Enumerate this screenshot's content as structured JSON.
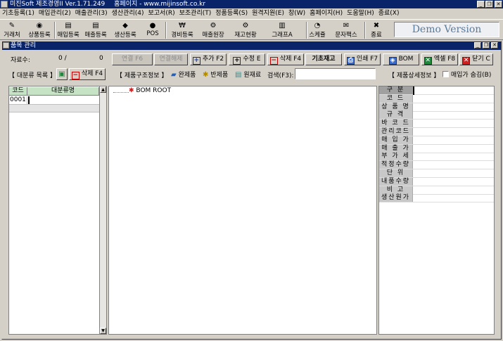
{
  "window": {
    "title_parts": [
      "미진Soft 제조경영II Ver.1.71.249",
      "홈페이지 - www.mijinsoft.co.kr"
    ],
    "min_label": "_",
    "restore_label": "❐",
    "close_label": "✕"
  },
  "menu": [
    "기초등록(1)",
    "매입관리(2)",
    "매출관리(3)",
    "생산관리(4)",
    "보고서(R)",
    "보조관리(T)",
    "정품등록(S)",
    "원격지원(E)",
    "창(W)",
    "홈페이지(H)",
    "도움말(H)",
    "종료(X)"
  ],
  "toolbar": [
    {
      "label": "거래처",
      "icon": "✎"
    },
    {
      "label": "상품등록",
      "icon": "◉"
    },
    {
      "label": "매입등록",
      "icon": "▤"
    },
    {
      "label": "매출등록",
      "icon": "▤"
    },
    {
      "label": "생산등록",
      "icon": "◆"
    },
    {
      "label": "POS",
      "icon": "●"
    },
    {
      "label": "경비등록",
      "icon": "₩"
    },
    {
      "label": "매출원장",
      "icon": "⚙"
    },
    {
      "label": "재고현황",
      "icon": "⚙"
    },
    {
      "label": "그래프A",
      "icon": "▥"
    },
    {
      "label": "스케쥴",
      "icon": "◔"
    },
    {
      "label": "문자팩스",
      "icon": "✉"
    },
    {
      "label": "종료",
      "icon": "✖"
    }
  ],
  "demo_text": "Demo Version",
  "child": {
    "title": "품목 관리",
    "record_label": "자료수:",
    "record_value": "0 /",
    "record_total": "0",
    "buttons": {
      "link": "연결 F6",
      "unlink": "연결해제",
      "add": "추가 F2",
      "edit": "수정 E",
      "delete": "삭제 F4",
      "base_stock": "기초재고",
      "print": "인쇄 F7",
      "bom": "BOM",
      "excel": "엑셀 F8",
      "close": "닫기 C"
    }
  },
  "left_section": {
    "title": "【 대분류 목록 】",
    "delete_label": "삭제 F4",
    "col_code": "코드",
    "col_name": "대분류명",
    "rows": [
      {
        "code": "0001",
        "name": ""
      }
    ]
  },
  "center_section": {
    "title": "【 제품구조정보 】",
    "finished": "완제품",
    "semi": "반제품",
    "raw": "원재료",
    "search_label": "검색(F3):",
    "search_value": "",
    "tree_root": "BOM ROOT"
  },
  "right_section": {
    "title": "【 제품상세정보 】",
    "hide_cost_label": "매입가 숨김(B)",
    "hide_cost_checked": false,
    "props": [
      "구 분",
      "코 드",
      "상 품 명",
      "규 격",
      "바 코 드",
      "관리코드",
      "매 입 가",
      "매 출 가",
      "부 가 세",
      "적정수량",
      "단 위",
      "내품수량",
      "비 고",
      "생산원가"
    ]
  }
}
